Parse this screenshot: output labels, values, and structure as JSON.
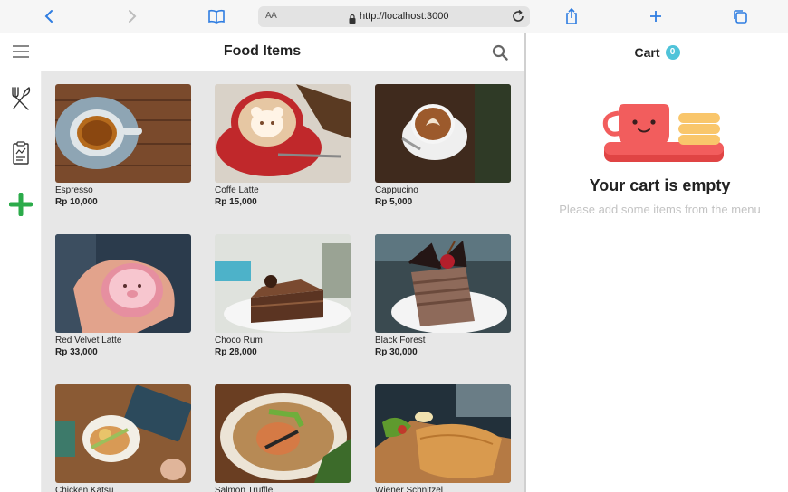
{
  "browser": {
    "aa_label": "AA",
    "url": "http://localhost:3000"
  },
  "header": {
    "title": "Food Items"
  },
  "cart": {
    "title": "Cart",
    "count": "0",
    "empty_title": "Your cart is empty",
    "empty_subtitle": "Please add some items from the menu"
  },
  "items": [
    {
      "name": "Espresso",
      "price": "Rp 10,000"
    },
    {
      "name": "Coffe Latte",
      "price": "Rp 15,000"
    },
    {
      "name": "Cappucino",
      "price": "Rp 5,000"
    },
    {
      "name": "Red Velvet Latte",
      "price": "Rp 33,000"
    },
    {
      "name": "Choco Rum",
      "price": "Rp 28,000"
    },
    {
      "name": "Black Forest",
      "price": "Rp 30,000"
    },
    {
      "name": "Chicken Katsu",
      "price": ""
    },
    {
      "name": "Salmon Truffle",
      "price": ""
    },
    {
      "name": "Wiener Schnitzel",
      "price": ""
    }
  ],
  "colors": {
    "accent_green": "#2bab4a",
    "badge_blue": "#4fc3d9",
    "cup_red": "#f25d5d"
  }
}
